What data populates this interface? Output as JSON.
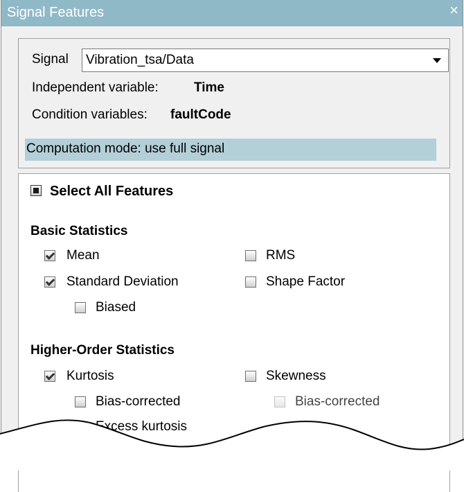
{
  "window": {
    "title": "Signal Features",
    "close_label": "×"
  },
  "signal": {
    "label": "Signal",
    "selected": "Vibration_tsa/Data",
    "independent_label": "Independent variable:",
    "independent_value": "Time",
    "condition_label": "Condition variables:",
    "condition_value": "faultCode",
    "computation_mode": "Computation mode: use full signal"
  },
  "features": {
    "select_all": {
      "label": "Select All Features",
      "state": "indeterminate"
    },
    "basic": {
      "heading": "Basic Statistics",
      "mean": {
        "label": "Mean",
        "checked": true
      },
      "rms": {
        "label": "RMS",
        "checked": false
      },
      "std": {
        "label": "Standard Deviation",
        "checked": true
      },
      "shape": {
        "label": "Shape Factor",
        "checked": false
      },
      "biased": {
        "label": "Biased",
        "checked": false
      }
    },
    "higher": {
      "heading": "Higher-Order Statistics",
      "kurtosis": {
        "label": "Kurtosis",
        "checked": true
      },
      "skewness": {
        "label": "Skewness",
        "checked": false
      },
      "kurt_bias": {
        "label": "Bias-corrected",
        "checked": false
      },
      "skew_bias": {
        "label": "Bias-corrected",
        "checked": false,
        "enabled": false
      },
      "excess": {
        "label": "Excess kurtosis",
        "checked": false
      }
    }
  },
  "colors": {
    "titlebar": "#90b9c7",
    "mode_highlight": "#b3cfd8"
  }
}
